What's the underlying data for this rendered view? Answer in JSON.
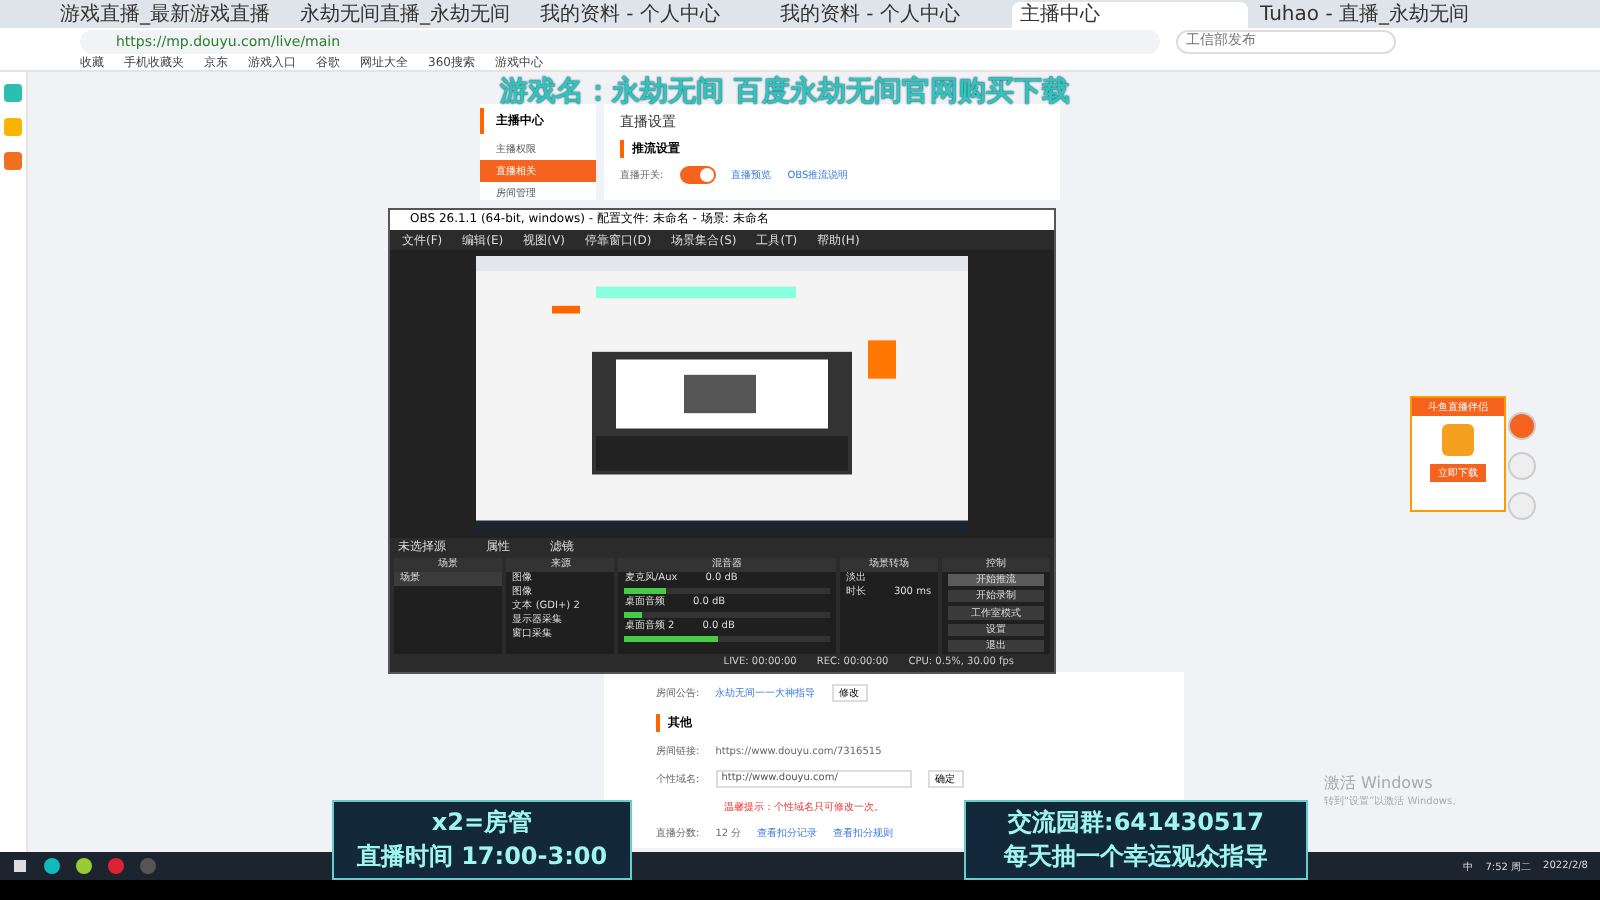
{
  "browser": {
    "tabs": [
      {
        "label": "游戏直播_最新游戏直播",
        "selected": false
      },
      {
        "label": "永劫无间直播_永劫无间",
        "selected": false
      },
      {
        "label": "我的资料 - 个人中心",
        "selected": false
      },
      {
        "label": "我的资料 - 个人中心",
        "selected": false
      },
      {
        "label": "主播中心",
        "selected": true
      },
      {
        "label": "Tuhao - 直播_永劫无间",
        "selected": false
      }
    ],
    "url": "https://mp.douyu.com/live/main",
    "search_placeholder": "工信部发布",
    "bookmarks": [
      "收藏",
      "手机收藏夹",
      "京东",
      "游戏入口",
      "谷歌",
      "网址大全",
      "360搜索",
      "游戏中心"
    ]
  },
  "banner": "游戏名：永劫无间 百度永劫无间官网购买下载",
  "sidebar": {
    "title": "主播中心",
    "items": [
      {
        "label": "主播权限",
        "selected": false
      },
      {
        "label": "直播相关",
        "selected": true
      },
      {
        "label": "房间管理",
        "selected": false
      }
    ]
  },
  "settings": {
    "title": "直播设置",
    "section": "推流设置",
    "switch_label": "直播开关:",
    "on": true,
    "links": [
      "直播预览",
      "OBS推流说明"
    ]
  },
  "obs": {
    "title": "OBS 26.1.1 (64-bit, windows) - 配置文件: 未命名 - 场景: 未命名",
    "menu": [
      "文件(F)",
      "编辑(E)",
      "视图(V)",
      "停靠窗口(D)",
      "场景集合(S)",
      "工具(T)",
      "帮助(H)"
    ],
    "scene_bar": "未选择源",
    "scene_bar_buttons": [
      "属性",
      "滤镜"
    ],
    "scenes": {
      "title": "场景",
      "items": [
        {
          "label": "场景",
          "selected": true
        }
      ]
    },
    "sources": {
      "title": "来源",
      "items": [
        {
          "label": "图像"
        },
        {
          "label": "图像"
        },
        {
          "label": "文本 (GDI+) 2"
        },
        {
          "label": "显示器采集"
        },
        {
          "label": "窗口采集"
        }
      ]
    },
    "mixer": {
      "title": "混音器",
      "channels": [
        {
          "name": "麦克风/Aux",
          "reading": "0.0 dB",
          "level": 0.2
        },
        {
          "name": "桌面音频",
          "reading": "0.0 dB",
          "level": 0.08
        },
        {
          "name": "桌面音频 2",
          "reading": "0.0 dB",
          "level": 0.45
        }
      ]
    },
    "transitions": {
      "title": "场景转场",
      "type": "淡出",
      "duration_label": "时长",
      "duration": "300 ms"
    },
    "controls": {
      "title": "控制",
      "buttons": [
        {
          "label": "开始推流",
          "selected": true
        },
        {
          "label": "开始录制",
          "selected": false
        },
        {
          "label": "工作室模式",
          "selected": false
        },
        {
          "label": "设置",
          "selected": false
        },
        {
          "label": "退出",
          "selected": false
        }
      ]
    },
    "status": [
      "LIVE: 00:00:00",
      "REC: 00:00:00",
      "CPU: 0.5%, 30.00 fps"
    ]
  },
  "notice": {
    "label": "房间公告:",
    "value": "永劫无间一一大神指导",
    "button": "修改"
  },
  "other": {
    "heading": "其他",
    "room_link_label": "房间链接:",
    "room_link": "https://www.douyu.com/7316515",
    "domain_label": "个性域名:",
    "domain_value": "http://www.douyu.com/",
    "domain_button": "确定",
    "domain_hint": "温馨提示：个性域名只可修改一次。",
    "score_label": "直播分数:",
    "score": "12 分",
    "score_links": [
      "查看扣分记录",
      "查看扣分规则"
    ]
  },
  "helper": {
    "title": "斗鱼直播伴侣",
    "button": "立即下载"
  },
  "activation": {
    "title": "激活 Windows",
    "text": "转到“设置”以激活 Windows。"
  },
  "overlay_left": {
    "line1": "x2=房管",
    "line2": "直播时间 17:00-3:00"
  },
  "overlay_right": {
    "line1": "交流园群:641430517",
    "line2": "每天抽一个幸运观众指导"
  },
  "taskbar": {
    "ime": "中",
    "time": "7:52 周二",
    "date": "2022/2/8"
  }
}
